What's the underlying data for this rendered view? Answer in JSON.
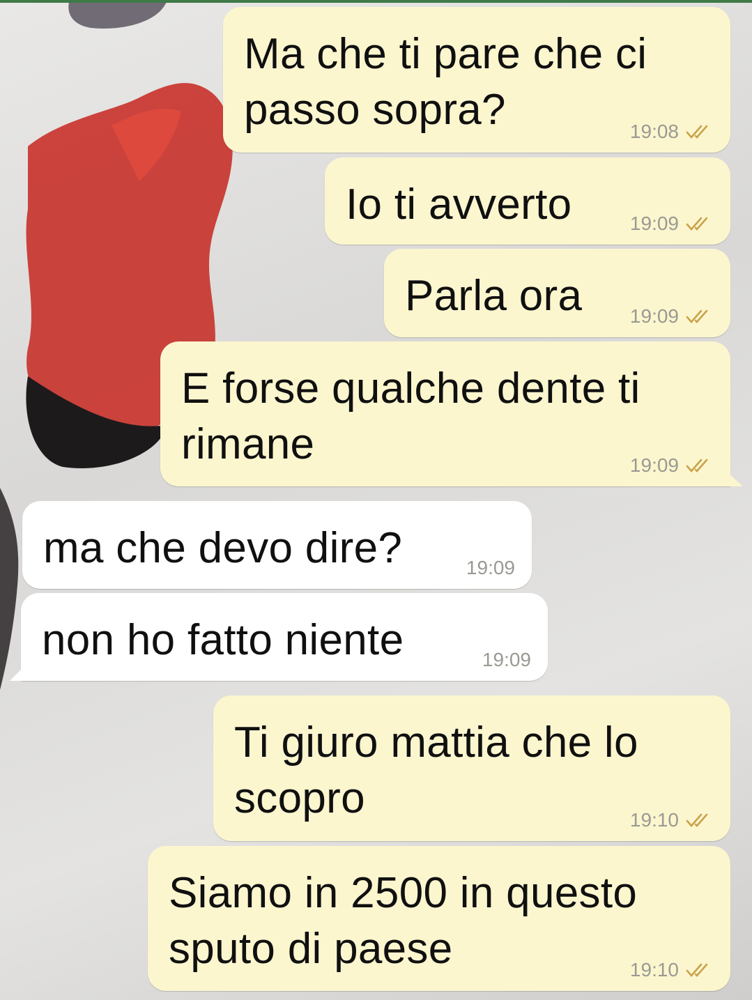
{
  "colors": {
    "outgoing_bubble": "#fcf6cf",
    "incoming_bubble": "#ffffff",
    "timestamp": "#9a9a92",
    "read_ticks": "#c9a24a",
    "top_bar": "#3f7a48"
  },
  "messages": [
    {
      "direction": "outgoing",
      "text": "Ma che ti pare che ci\npasso sopra?",
      "time": "19:08",
      "status_icon": "double-check-icon"
    },
    {
      "direction": "outgoing",
      "text": "Io ti avverto",
      "time": "19:09",
      "status_icon": "double-check-icon"
    },
    {
      "direction": "outgoing",
      "text": "Parla ora",
      "time": "19:09",
      "status_icon": "double-check-icon"
    },
    {
      "direction": "outgoing",
      "text": "E forse qualche dente ti\nrimane",
      "time": "19:09",
      "status_icon": "double-check-icon"
    },
    {
      "direction": "incoming",
      "text": "ma che devo dire?",
      "time": "19:09"
    },
    {
      "direction": "incoming",
      "text": "non ho fatto niente",
      "time": "19:09"
    },
    {
      "direction": "outgoing",
      "text": "Ti giuro mattia che lo\nscopro",
      "time": "19:10",
      "status_icon": "double-check-icon"
    },
    {
      "direction": "outgoing",
      "text": "Siamo in 2500 in questo\nsputo di paese",
      "time": "19:10",
      "status_icon": "double-check-icon"
    }
  ]
}
